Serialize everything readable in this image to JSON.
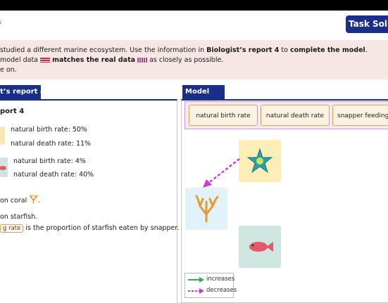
{
  "header": {
    "back_glyph": "‹",
    "task_button_label": "Task Solution"
  },
  "banner": {
    "line1_pre": "studied a different marine ecosystem. Use the information in ",
    "line1_bold1": "Biologist’s report 4",
    "line1_mid": " to ",
    "line1_bold2": "complete the model",
    "line1_post": ".",
    "line2_pre": "model data ",
    "line2_bold": "matches the real data",
    "line2_post": " as closely as possible.",
    "line3": "e on."
  },
  "left_panel": {
    "tab_label": "t’s report 4",
    "heading": "port 4",
    "species": [
      {
        "birth": "natural birth rate: 50%",
        "death": "natural death rate: 11%"
      },
      {
        "birth": "natural birth rate: 4%",
        "death": "natural death rate: 40%"
      }
    ],
    "line_coral": "on coral",
    "line_coral_end": ".",
    "line_starfish": "on starfish.",
    "chip_text": "g rate",
    "line_proportion": "is the proportion of starfish eaten by snapper."
  },
  "right_panel": {
    "tab_label": "Model",
    "rate_buttons": [
      "natural birth rate",
      "natural death rate",
      "snapper feeding rate"
    ],
    "legend": {
      "increases": "increases",
      "decreases": "decreases"
    },
    "cards": [
      "starfish",
      "coral",
      "snapper"
    ]
  },
  "colors": {
    "navy": "#1a2f8a",
    "banner_bg": "#f6e6e4",
    "increase_arrow": "#2db34a",
    "decrease_arrow": "#c23fcf"
  }
}
